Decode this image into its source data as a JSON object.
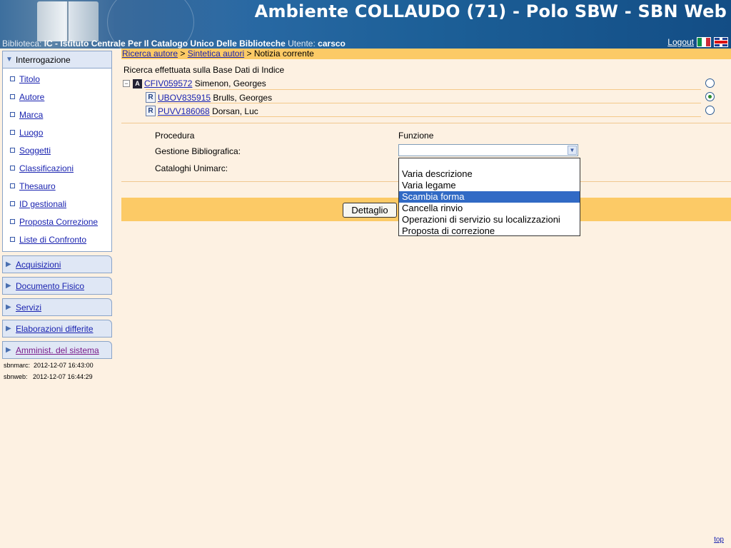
{
  "header": {
    "app_title": "Ambiente COLLAUDO (71) - Polo SBW - SBN Web",
    "library_label": "Biblioteca:",
    "library_name": "IC - Istituto Centrale Per Il Catalogo Unico Delle Biblioteche",
    "user_label": "Utente:",
    "user_name": "carsco",
    "logout": "Logout"
  },
  "sidebar": {
    "open_section": "Interrogazione",
    "sub_items": [
      "Titolo",
      "Autore",
      "Marca",
      "Luogo",
      "Soggetti",
      "Classificazioni",
      "Thesauro",
      "ID gestionali",
      "Proposta Correzione",
      "Liste di Confronto"
    ],
    "sections": [
      "Acquisizioni",
      "Documento Fisico",
      "Servizi",
      "Elaborazioni differite",
      "Amminist. del sistema"
    ],
    "timestamps": [
      "sbnmarc:  2012-12-07 16:43:00",
      "sbnweb:   2012-12-07 16:44:29"
    ]
  },
  "breadcrumb": {
    "crumb1": "Ricerca autore",
    "sep": " > ",
    "crumb2": "Sintetica autori",
    "current": "Notizia corrente"
  },
  "search_info": "Ricerca effettuata sulla Base Dati di Indice",
  "tree": [
    {
      "id": "CFIV059572",
      "name": "Simenon, Georges",
      "selected": false
    },
    {
      "id": "UBOV835915",
      "name": "Brulls, Georges",
      "selected": true
    },
    {
      "id": "PUVV186068",
      "name": "Dorsan, Luc",
      "selected": false
    }
  ],
  "form": {
    "procedura_label": "Procedura",
    "funzione_label": "Funzione",
    "gestione_label": "Gestione Bibliografica:",
    "cataloghi_label": "Cataloghi Unimarc:",
    "select_value": ""
  },
  "dropdown_options": [
    "",
    "Varia descrizione",
    "Varia legame",
    "Scambia forma",
    "Cancella rinvio",
    "Operazioni di servizio su localizzazioni",
    "Proposta di correzione"
  ],
  "dropdown_selected_index": 3,
  "detail_button": "Dettaglio",
  "top_link": "top"
}
